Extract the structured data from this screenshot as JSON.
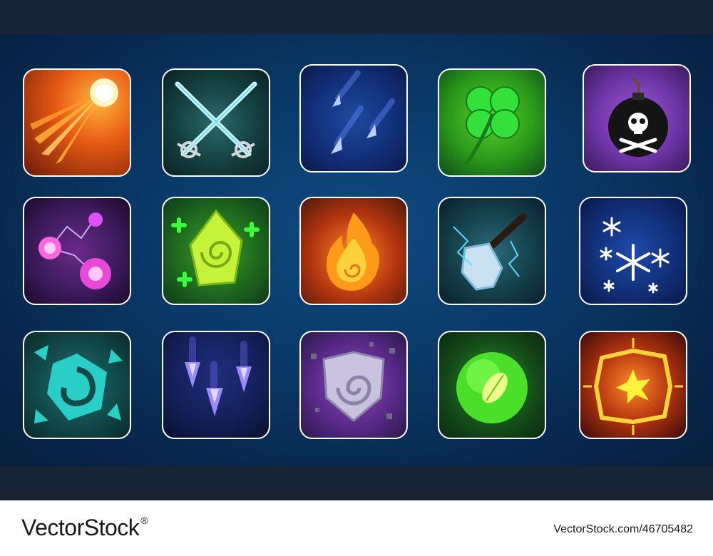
{
  "footer": {
    "brand": "VectorStock",
    "registered_mark": "®",
    "image_id": "VectorStock.com/46705482"
  },
  "icons": [
    {
      "name": "comet-icon",
      "palette": [
        "#ff9b1f",
        "#5a1a0a"
      ]
    },
    {
      "name": "crossed-swords-icon",
      "palette": [
        "#1f5a5a",
        "#0a2a2e"
      ]
    },
    {
      "name": "ice-shards-icon",
      "palette": [
        "#1a3a8a",
        "#0a1a4a"
      ]
    },
    {
      "name": "four-leaf-clover-icon",
      "palette": [
        "#3bbf1f",
        "#0f4a1a"
      ]
    },
    {
      "name": "bomb-skull-icon",
      "palette": [
        "#8a3aaf",
        "#3a1a5a"
      ]
    },
    {
      "name": "arcane-lightning-orbs-icon",
      "palette": [
        "#8a2aaa",
        "#2a0a3a"
      ]
    },
    {
      "name": "healing-crystal-icon",
      "palette": [
        "#3fae2a",
        "#0f3a1a"
      ]
    },
    {
      "name": "fireball-icon",
      "palette": [
        "#ff7a1f",
        "#4a1a0a"
      ]
    },
    {
      "name": "lightning-hammer-icon",
      "palette": [
        "#1a5a6a",
        "#0a2030"
      ]
    },
    {
      "name": "snowflakes-icon",
      "palette": [
        "#1a3a9a",
        "#081a4a"
      ]
    },
    {
      "name": "earth-rune-shield-icon",
      "palette": [
        "#1a6a6a",
        "#0a2a2a"
      ]
    },
    {
      "name": "falling-crystals-icon",
      "palette": [
        "#1a2a6a",
        "#0a1030"
      ]
    },
    {
      "name": "stone-shield-icon",
      "palette": [
        "#7a3aaa",
        "#2a1a4a"
      ]
    },
    {
      "name": "leaf-orb-icon",
      "palette": [
        "#2a9a2a",
        "#0a2a12"
      ]
    },
    {
      "name": "explosion-burst-icon",
      "palette": [
        "#ff7a1f",
        "#3a0a0a"
      ]
    }
  ]
}
